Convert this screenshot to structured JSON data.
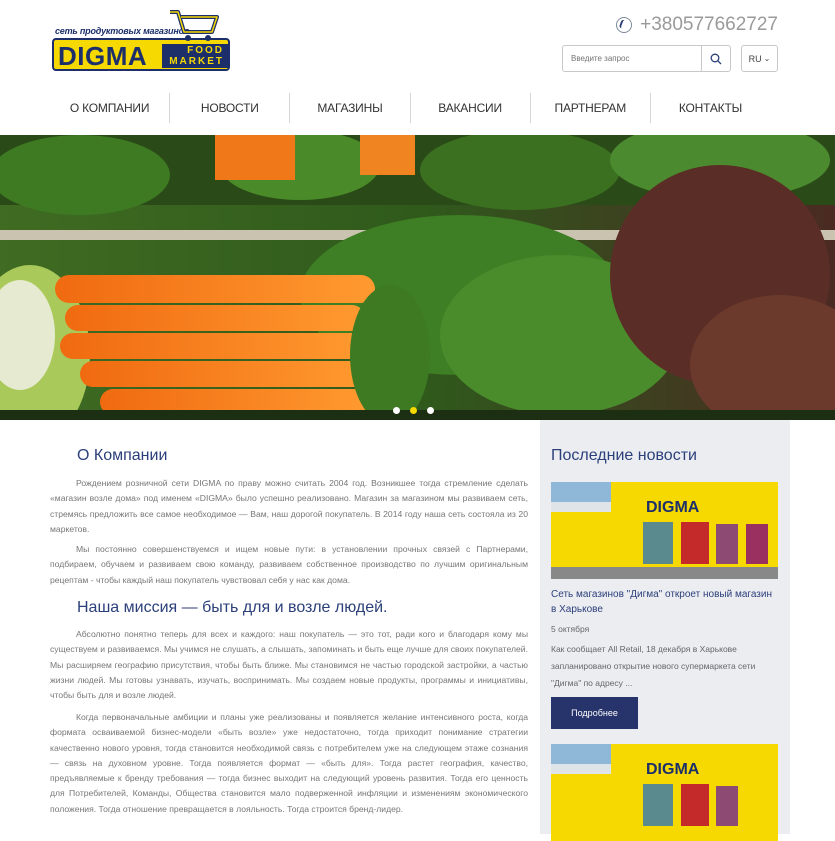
{
  "header": {
    "logo": {
      "tagline": "сеть продуктовых магазинов",
      "brand": "DIGMA",
      "sub1": "FOOD",
      "sub2": "MARKET"
    },
    "phone": "+380577662727",
    "search": {
      "placeholder": "Введите запрос"
    },
    "language": "RU"
  },
  "nav": {
    "items": [
      {
        "label": "О компании"
      },
      {
        "label": "Новости"
      },
      {
        "label": "Магазины"
      },
      {
        "label": "Вакансии"
      },
      {
        "label": "Партнерам"
      },
      {
        "label": "Контакты"
      }
    ]
  },
  "slider": {
    "active_slide": 2,
    "slide_count": 3
  },
  "main": {
    "about_title": "О Компании",
    "about_p1": "Рождением розничной сети DIGMA по праву можно считать 2004 год. Возникшее тогда стремление сделать «магазин возле дома» под именем «DIGMA» было успешно реализовано. Магазин за магазином мы развиваем сеть, стремясь предложить все самое необходимое — Вам, наш дорогой покупатель. В 2014 году наша сеть состояла из 20 маркетов.",
    "about_p2": "Мы постоянно совершенствуемся и ищем новые пути: в установлении прочных связей с Партнерами, подбираем, обучаем и развиваем свою команду, развиваем собственное производство по лучшим оригинальным рецептам - чтобы каждый наш покупатель чувствовал себя у нас как дома.",
    "mission_title": "Наша миссия — быть для и возле людей.",
    "mission_p1": "Абсолютно понятно теперь для всех и каждого: наш покупатель — это тот, ради кого и благодаря кому мы существуем и развиваемся. Мы учимся не слушать, а слышать, запоминать и быть еще лучше для своих покупателей. Мы расширяем географию присутствия, чтобы быть ближе. Мы становимся не частью городской застройки, а частью жизни людей. Мы готовы узнавать, изучать, воспринимать. Мы создаем новые продукты, программы и инициативы, чтобы быть для и возле людей.",
    "mission_p2": "Когда первоначальные амбиции и планы уже реализованы и появляется желание интенсивного роста, когда формата осваиваемой бизнес-модели «быть возле» уже недостаточно, тогда приходит понимание стратегии качественно нового уровня, тогда становится необходимой связь с потребителем уже на следующем этаже сознания — связь на духовном уровне. Тогда появляется формат — «быть для». Тогда растет география, качество, предъявляемые к бренду требования — тогда бизнес выходит на следующий уровень развития. Тогда его ценность для Потребителей, Команды, Общества становится мало подверженной инфляции и изменениям экономического положения. Тогда отношение превращается в лояльность. Тогда строится бренд-лидер."
  },
  "sidebar": {
    "title": "Последние новости",
    "news": [
      {
        "title": "Сеть магазинов \"Дигма\" откроет новый магазин в Харькове",
        "date": "5 октября",
        "text": "Как сообщает All Retail, 18 декабря в Харькове запланировано открытие нового супермаркета сети \"Дигма\" по адресу ...",
        "button": "Подробнее",
        "store_sign": "DIGMA"
      },
      {
        "store_sign": "DIGMA"
      }
    ]
  },
  "colors": {
    "brand_yellow": "#f5d900",
    "brand_navy": "#1c2f6b",
    "heading": "#2b3f7a",
    "button": "#27336b",
    "sidebar_bg": "#ecedf1"
  }
}
